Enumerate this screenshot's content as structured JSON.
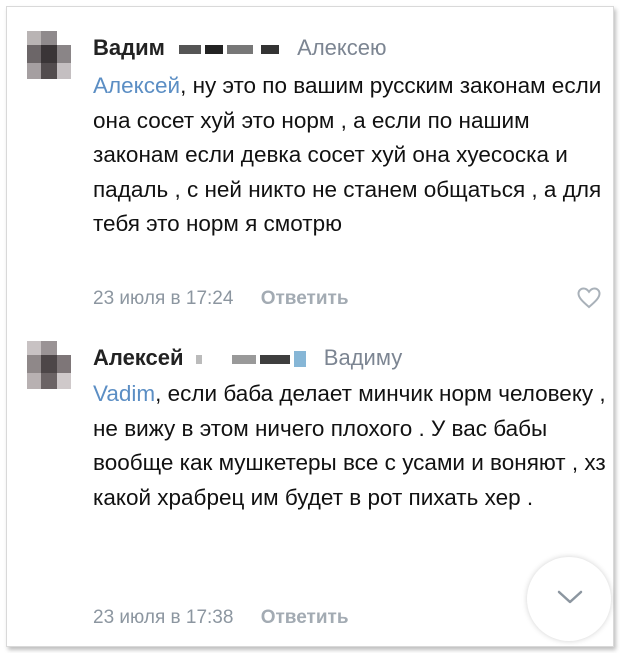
{
  "comments": [
    {
      "author": "Вадим",
      "reply_to": "Алексею",
      "mention": "Алексей",
      "text": ", ну это по вашим русским законам если она сосет хуй это норм , а если по нашим законам если девка сосет хуй она хуесоска и падаль , с ней никто не станем общаться , а для тебя это норм я смотрю",
      "time": "23 июля в 17:24",
      "reply_label": "Ответить"
    },
    {
      "author": "Алексей",
      "reply_to": "Вадиму",
      "mention": "Vadim",
      "text": ", если баба делает минчик норм человеку , не вижу в этом ничего плохого . У вас бабы вообще как мушкетеры все с усами и воняют , хз какой храбрец им будет в рот пихать хер .",
      "time": "23 июля в 17:38",
      "reply_label": "Ответить"
    }
  ],
  "icons": {
    "like": "heart-outline-icon",
    "scroll_down": "chevron-down-icon"
  },
  "colors": {
    "mention": "#5b8ec4",
    "meta": "#8c96a0",
    "author": "#222222"
  }
}
